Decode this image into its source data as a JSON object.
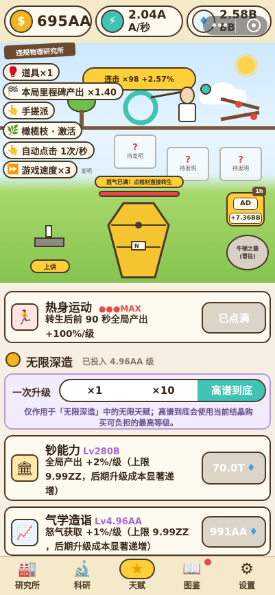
{
  "currencies": [
    {
      "icon": "money-bag-icon",
      "glyph": "$",
      "value": "695AA"
    },
    {
      "icon": "lightning-icon",
      "glyph": "⚡",
      "value": "2.04A",
      "sub": "A/秒"
    },
    {
      "icon": "diamond-icon",
      "glyph": "♦",
      "value": "2.58B",
      "sub": "BB"
    }
  ],
  "scene": {
    "lab_name": "违规物理研究所",
    "buffs": [
      {
        "icon": "boxing-glove-icon",
        "glyph": "🥊",
        "label": "道具×1"
      },
      {
        "icon": "checkered-flag-icon",
        "glyph": "🏁",
        "label": "本局里程碑产出 ×1.40"
      },
      {
        "icon": "hand-pointer-icon",
        "glyph": "👆",
        "label": "手搓派"
      },
      {
        "icon": "olive-branch-icon",
        "glyph": "🌿",
        "label": "橄榄枝 · 激活"
      },
      {
        "icon": "hand-pointer-icon",
        "glyph": "👆",
        "label": "自动点击 1次/秒"
      },
      {
        "icon": "fast-forward-icon",
        "glyph": "⏩",
        "label": "游戏速度×3"
      }
    ],
    "combo": "连击 ×98 +2.57%",
    "invention_placeholder": "待发明",
    "invention_cap": "发明",
    "rage_text": "怒气已满！点棺材直接转生",
    "ad_badge": "1h",
    "ad_label": "AD",
    "ad_value": "+7.36BB",
    "offer_button": "上供",
    "isaac_label": "牛顿之墓",
    "isaac_sub": "(冒往)",
    "coffin_label": "N"
  },
  "warmup": {
    "title": "热身运动",
    "dots": "●●●",
    "max": "MAX",
    "desc_line1": "转生后前 90 秒全局产出",
    "desc_line2": "+100%/级",
    "button": "已点满"
  },
  "abyss": {
    "title": "无限深造",
    "invested": "已投入 4.96AA 级"
  },
  "upgrade_once": {
    "label": "一次升级",
    "options": [
      "×1",
      "×10",
      "高谱到底"
    ],
    "selected": 2,
    "note_line1": "仅作用于「无限深造」中的无限天赋；高谱到底会使用当前结晶购",
    "note_line2": "买可负担的最高等级。"
  },
  "talents": [
    {
      "icon": "bank-icon",
      "glyph": "🏛",
      "title": "钞能力",
      "level": "Lv280B",
      "desc": [
        "全局产出 +2%/级（上限",
        "9.99ZZ，后期升级成本显著递",
        "增）"
      ],
      "cost": "70.0T"
    },
    {
      "icon": "chart-trend-icon",
      "glyph": "📈",
      "title": "气学造诣",
      "level": "Lv4.96AA",
      "desc": [
        "怒气获取 +1%/级（上限 9.99ZZ",
        "，后期升级成本显著递增）"
      ],
      "cost": "991AA"
    }
  ],
  "nav": [
    {
      "icon": "factory-icon",
      "glyph": "🏭",
      "label": "研究所"
    },
    {
      "icon": "microscope-icon",
      "glyph": "🔬",
      "label": "科研"
    },
    {
      "icon": "star-icon",
      "glyph": "★",
      "label": "天赋"
    },
    {
      "icon": "book-icon",
      "glyph": "📖",
      "label": "图鉴"
    },
    {
      "icon": "gear-icon",
      "glyph": "⚙",
      "label": "设置"
    }
  ],
  "colors": {
    "accent_teal": "#3ec3b5",
    "max_red": "#e84a4a",
    "level_purple": "#a56cd6",
    "coin_gold": "#f2b51f"
  }
}
